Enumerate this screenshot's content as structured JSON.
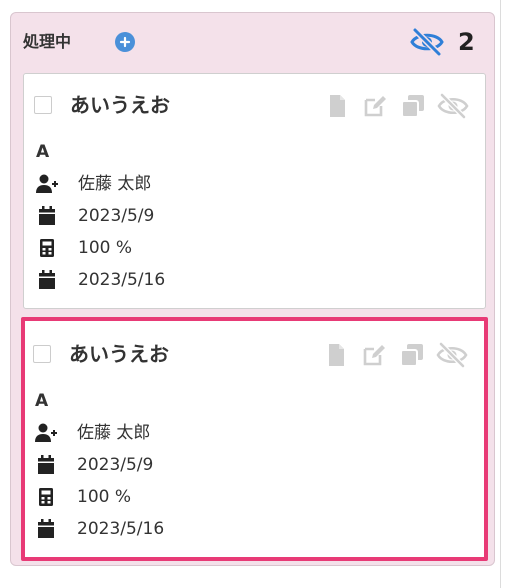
{
  "column": {
    "title": "処理中",
    "count": "2"
  },
  "cards": [
    {
      "title": "あいうえお",
      "font_symbol": "A",
      "assignee": "佐藤 太郎",
      "start_date": "2023/5/9",
      "progress": "100 %",
      "due_date": "2023/5/16"
    },
    {
      "title": "あいうえお",
      "font_symbol": "A",
      "assignee": "佐藤 太郎",
      "start_date": "2023/5/9",
      "progress": "100 %",
      "due_date": "2023/5/16"
    }
  ],
  "colors": {
    "column_bg": "#f4e1ea",
    "accent_blue": "#2f7fd8",
    "highlight_border": "#e83a76",
    "icon_gray": "#cfcfcf",
    "text_dark": "#333333"
  }
}
